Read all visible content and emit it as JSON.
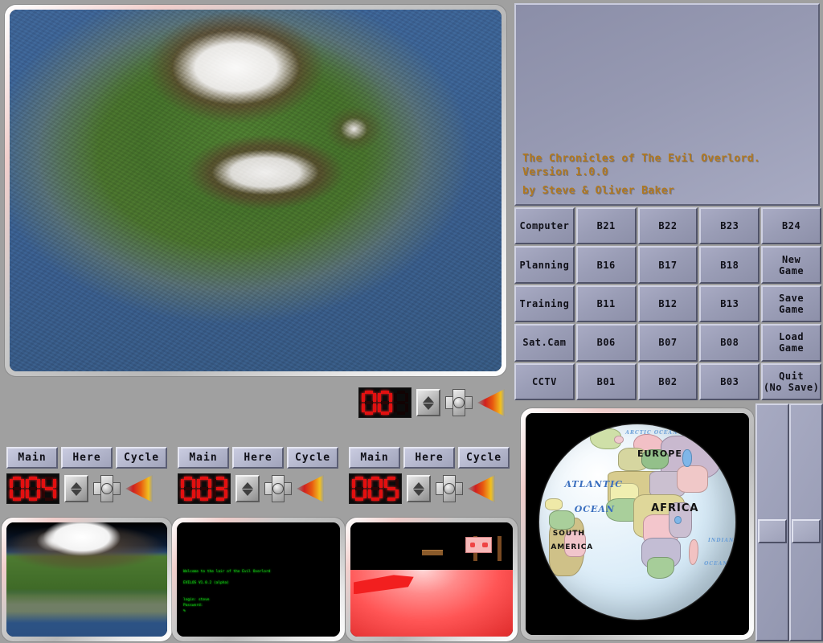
{
  "app": {
    "title_line1": "The Chronicles of The Evil Overlord.",
    "title_line2": "Version 1.0.0",
    "title_line3": "by Steve & Oliver Baker",
    "accent_color": "#b07820",
    "panel_color": "#9699b2",
    "led_color": "#e21010"
  },
  "button_grid": {
    "rows": [
      {
        "cells": [
          {
            "label": "Computer",
            "name": "button-computer"
          },
          {
            "label": "B21",
            "name": "button-b21"
          },
          {
            "label": "B22",
            "name": "button-b22"
          },
          {
            "label": "B23",
            "name": "button-b23"
          },
          {
            "label": "B24",
            "name": "button-b24"
          }
        ]
      },
      {
        "cells": [
          {
            "label": "Planning",
            "name": "button-planning"
          },
          {
            "label": "B16",
            "name": "button-b16"
          },
          {
            "label": "B17",
            "name": "button-b17"
          },
          {
            "label": "B18",
            "name": "button-b18"
          },
          {
            "label": "New\nGame",
            "name": "button-new-game"
          }
        ]
      },
      {
        "cells": [
          {
            "label": "Training",
            "name": "button-training"
          },
          {
            "label": "B11",
            "name": "button-b11"
          },
          {
            "label": "B12",
            "name": "button-b12"
          },
          {
            "label": "B13",
            "name": "button-b13"
          },
          {
            "label": "Save\nGame",
            "name": "button-save-game"
          }
        ]
      },
      {
        "cells": [
          {
            "label": "Sat.Cam",
            "name": "button-sat-cam"
          },
          {
            "label": "B06",
            "name": "button-b06"
          },
          {
            "label": "B07",
            "name": "button-b07"
          },
          {
            "label": "B08",
            "name": "button-b08"
          },
          {
            "label": "Load\nGame",
            "name": "button-load-game"
          }
        ]
      },
      {
        "cells": [
          {
            "label": "CCTV",
            "name": "button-cctv"
          },
          {
            "label": "B01",
            "name": "button-b01"
          },
          {
            "label": "B02",
            "name": "button-b02"
          },
          {
            "label": "B03",
            "name": "button-b03"
          },
          {
            "label": "Quit\n(No Save)",
            "name": "button-quit-no-save"
          }
        ]
      }
    ]
  },
  "main_camera": {
    "display_value": "00",
    "digits": [
      "0",
      "0",
      " "
    ]
  },
  "cameras": [
    {
      "name": "camera-1",
      "tabs": [
        {
          "label": "Main",
          "name": "tab-main"
        },
        {
          "label": "Here",
          "name": "tab-here"
        },
        {
          "label": "Cycle",
          "name": "tab-cycle"
        }
      ],
      "display_value": "004",
      "digits": [
        "0",
        "0",
        "4"
      ],
      "view": "terrain-ground-view"
    },
    {
      "name": "camera-2",
      "tabs": [
        {
          "label": "Main",
          "name": "tab-main"
        },
        {
          "label": "Here",
          "name": "tab-here"
        },
        {
          "label": "Cycle",
          "name": "tab-cycle"
        }
      ],
      "display_value": "003",
      "digits": [
        "0",
        "0",
        "3"
      ],
      "view": "terminal-console"
    },
    {
      "name": "camera-3",
      "tabs": [
        {
          "label": "Main",
          "name": "tab-main"
        },
        {
          "label": "Here",
          "name": "tab-here"
        },
        {
          "label": "Cycle",
          "name": "tab-cycle"
        }
      ],
      "display_value": "005",
      "digits": [
        "0",
        "0",
        "5"
      ],
      "view": "red-room-interior"
    }
  ],
  "terminal": {
    "lines": "Welcome to the lair of the Evil Overlord\n\nEVILOS V1.0.2 (alpha)\n\n\nlogin: steve\nPassword:\n%"
  },
  "globe": {
    "labels": [
      {
        "text": "EUROPE",
        "name": "globe-label-europe"
      },
      {
        "text": "AFRICA",
        "name": "globe-label-africa"
      },
      {
        "text": "ATLANTIC",
        "name": "globe-label-atlantic"
      },
      {
        "text": "OCEAN",
        "name": "globe-label-ocean"
      },
      {
        "text": "SOUTH",
        "name": "globe-label-south"
      },
      {
        "text": "AMERICA",
        "name": "globe-label-america"
      },
      {
        "text": "ARCTIC OCEAN",
        "name": "globe-label-arctic-ocean"
      },
      {
        "text": "INDIAN",
        "name": "globe-label-indian"
      },
      {
        "text": "OCEAN",
        "name": "globe-label-indian-ocean"
      }
    ]
  },
  "sliders": [
    {
      "name": "vertical-slider-left",
      "value_pct": 52
    },
    {
      "name": "vertical-slider-right",
      "value_pct": 52
    }
  ],
  "icons": {
    "up_down": "up-down-spinner-icon",
    "dpad": "dpad-compass-icon",
    "play": "play-triangle-icon"
  }
}
